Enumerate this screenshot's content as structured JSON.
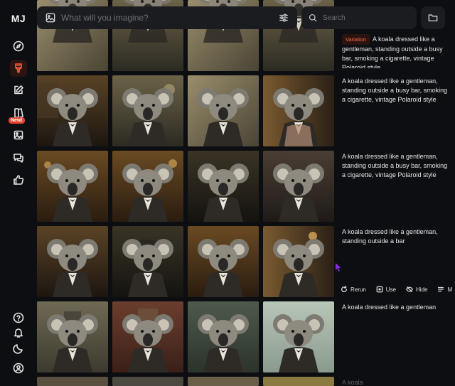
{
  "app": {
    "logo": "MJ"
  },
  "sidebar": {
    "items": [
      {
        "name": "explore",
        "icon": "compass-icon"
      },
      {
        "name": "create",
        "icon": "brush-icon",
        "active": true
      },
      {
        "name": "edit",
        "icon": "edit-icon"
      },
      {
        "name": "personalize",
        "icon": "book-icon",
        "badge": "New!"
      },
      {
        "name": "organize",
        "icon": "image-icon"
      },
      {
        "name": "chat",
        "icon": "chat-icon"
      },
      {
        "name": "rank",
        "icon": "thumbs-up-icon"
      }
    ],
    "bottom": [
      {
        "name": "help",
        "icon": "help-icon"
      },
      {
        "name": "notifications",
        "icon": "bell-icon"
      },
      {
        "name": "theme",
        "icon": "moon-icon"
      },
      {
        "name": "profile",
        "icon": "profile-icon"
      }
    ]
  },
  "prompt_bar": {
    "placeholder": "What will you imagine?"
  },
  "search": {
    "placeholder": "Search"
  },
  "jobs": [
    {
      "tag": "Variation",
      "prompt": "A koala dressed like a gentleman, standing outside a busy bar, smoking a cigarette, vintage Polaroid style"
    },
    {
      "prompt": "A koala dressed like a gentleman, standing outside a busy bar, smoking a cigarette, vintage Polaroid style"
    },
    {
      "prompt": "A koala dressed like a gentleman, standing outside a busy bar, smoking a cigarette, vintage Polaroid style"
    },
    {
      "prompt": "A koala dressed like a gentleman, standing outside a bar"
    },
    {
      "prompt": "A koala dressed like a gentleman"
    },
    {
      "prompt": "A koala"
    }
  ],
  "actions": {
    "rerun": "Rerun",
    "use": "Use",
    "hide": "Hide",
    "more": "M"
  },
  "colors": {
    "accent": "#ff5a3c",
    "badge": "#e8432e",
    "background": "#0d0e11"
  }
}
